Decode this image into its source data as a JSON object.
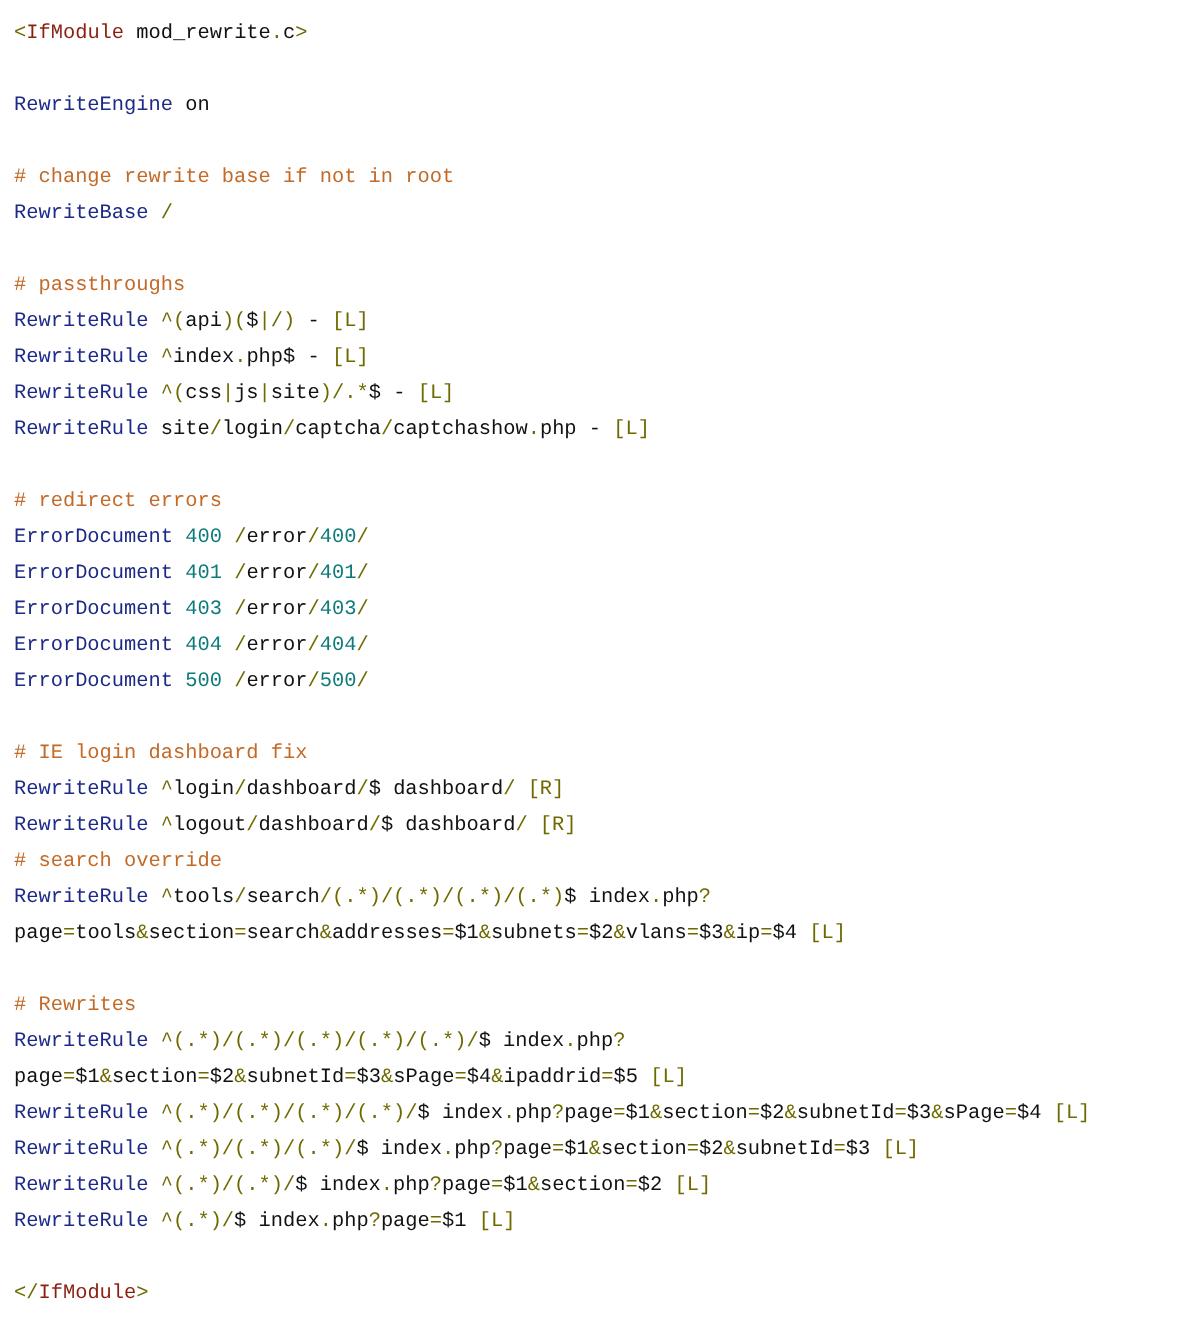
{
  "code_blocks": [
    {
      "lines": [
        [
          {
            "kind": "punct",
            "text": "<"
          },
          {
            "kind": "tag",
            "text": "IfModule"
          },
          {
            "kind": "plain",
            "text": " mod_rewrite"
          },
          {
            "kind": "punct",
            "text": "."
          },
          {
            "kind": "plain",
            "text": "c"
          },
          {
            "kind": "punct",
            "text": ">"
          }
        ]
      ]
    },
    {
      "lines": [
        [
          {
            "kind": "keyword",
            "text": "RewriteEngine"
          },
          {
            "kind": "plain",
            "text": " on"
          }
        ]
      ]
    },
    {
      "lines": [
        [
          {
            "kind": "comment",
            "text": "# change rewrite base if not in root"
          }
        ],
        [
          {
            "kind": "keyword",
            "text": "RewriteBase"
          },
          {
            "kind": "punct",
            "text": " /"
          }
        ]
      ]
    },
    {
      "lines": [
        [
          {
            "kind": "comment",
            "text": "# passthroughs"
          }
        ],
        [
          {
            "kind": "keyword",
            "text": "RewriteRule"
          },
          {
            "kind": "punct",
            "text": " ^("
          },
          {
            "kind": "plain",
            "text": "api"
          },
          {
            "kind": "punct",
            "text": ")("
          },
          {
            "kind": "plain",
            "text": "$"
          },
          {
            "kind": "punct",
            "text": "|/)"
          },
          {
            "kind": "plain",
            "text": " - "
          },
          {
            "kind": "punct",
            "text": "[L]"
          }
        ],
        [
          {
            "kind": "keyword",
            "text": "RewriteRule"
          },
          {
            "kind": "punct",
            "text": " ^"
          },
          {
            "kind": "plain",
            "text": "index"
          },
          {
            "kind": "punct",
            "text": "."
          },
          {
            "kind": "plain",
            "text": "php$ - "
          },
          {
            "kind": "punct",
            "text": "[L]"
          }
        ],
        [
          {
            "kind": "keyword",
            "text": "RewriteRule"
          },
          {
            "kind": "punct",
            "text": " ^("
          },
          {
            "kind": "plain",
            "text": "css"
          },
          {
            "kind": "punct",
            "text": "|"
          },
          {
            "kind": "plain",
            "text": "js"
          },
          {
            "kind": "punct",
            "text": "|"
          },
          {
            "kind": "plain",
            "text": "site"
          },
          {
            "kind": "punct",
            "text": ")/.*"
          },
          {
            "kind": "plain",
            "text": "$ - "
          },
          {
            "kind": "punct",
            "text": "[L]"
          }
        ],
        [
          {
            "kind": "keyword",
            "text": "RewriteRule"
          },
          {
            "kind": "plain",
            "text": " site"
          },
          {
            "kind": "punct",
            "text": "/"
          },
          {
            "kind": "plain",
            "text": "login"
          },
          {
            "kind": "punct",
            "text": "/"
          },
          {
            "kind": "plain",
            "text": "captcha"
          },
          {
            "kind": "punct",
            "text": "/"
          },
          {
            "kind": "plain",
            "text": "captchashow"
          },
          {
            "kind": "punct",
            "text": "."
          },
          {
            "kind": "plain",
            "text": "php - "
          },
          {
            "kind": "punct",
            "text": "[L]"
          }
        ]
      ]
    },
    {
      "lines": [
        [
          {
            "kind": "comment",
            "text": "# redirect errors"
          }
        ],
        [
          {
            "kind": "keyword",
            "text": "ErrorDocument"
          },
          {
            "kind": "number",
            "text": " 400"
          },
          {
            "kind": "punct",
            "text": " /"
          },
          {
            "kind": "plain",
            "text": "error"
          },
          {
            "kind": "punct",
            "text": "/"
          },
          {
            "kind": "number",
            "text": "400"
          },
          {
            "kind": "punct",
            "text": "/"
          }
        ],
        [
          {
            "kind": "keyword",
            "text": "ErrorDocument"
          },
          {
            "kind": "number",
            "text": " 401"
          },
          {
            "kind": "punct",
            "text": " /"
          },
          {
            "kind": "plain",
            "text": "error"
          },
          {
            "kind": "punct",
            "text": "/"
          },
          {
            "kind": "number",
            "text": "401"
          },
          {
            "kind": "punct",
            "text": "/"
          }
        ],
        [
          {
            "kind": "keyword",
            "text": "ErrorDocument"
          },
          {
            "kind": "number",
            "text": " 403"
          },
          {
            "kind": "punct",
            "text": " /"
          },
          {
            "kind": "plain",
            "text": "error"
          },
          {
            "kind": "punct",
            "text": "/"
          },
          {
            "kind": "number",
            "text": "403"
          },
          {
            "kind": "punct",
            "text": "/"
          }
        ],
        [
          {
            "kind": "keyword",
            "text": "ErrorDocument"
          },
          {
            "kind": "number",
            "text": " 404"
          },
          {
            "kind": "punct",
            "text": " /"
          },
          {
            "kind": "plain",
            "text": "error"
          },
          {
            "kind": "punct",
            "text": "/"
          },
          {
            "kind": "number",
            "text": "404"
          },
          {
            "kind": "punct",
            "text": "/"
          }
        ],
        [
          {
            "kind": "keyword",
            "text": "ErrorDocument"
          },
          {
            "kind": "number",
            "text": " 500"
          },
          {
            "kind": "punct",
            "text": " /"
          },
          {
            "kind": "plain",
            "text": "error"
          },
          {
            "kind": "punct",
            "text": "/"
          },
          {
            "kind": "number",
            "text": "500"
          },
          {
            "kind": "punct",
            "text": "/"
          }
        ]
      ]
    },
    {
      "lines": [
        [
          {
            "kind": "comment",
            "text": "# IE login dashboard fix"
          }
        ],
        [
          {
            "kind": "keyword",
            "text": "RewriteRule"
          },
          {
            "kind": "punct",
            "text": " ^"
          },
          {
            "kind": "plain",
            "text": "login"
          },
          {
            "kind": "punct",
            "text": "/"
          },
          {
            "kind": "plain",
            "text": "dashboard"
          },
          {
            "kind": "punct",
            "text": "/"
          },
          {
            "kind": "plain",
            "text": "$ dashboard"
          },
          {
            "kind": "punct",
            "text": "/ [R]"
          }
        ],
        [
          {
            "kind": "keyword",
            "text": "RewriteRule"
          },
          {
            "kind": "punct",
            "text": " ^"
          },
          {
            "kind": "plain",
            "text": "logout"
          },
          {
            "kind": "punct",
            "text": "/"
          },
          {
            "kind": "plain",
            "text": "dashboard"
          },
          {
            "kind": "punct",
            "text": "/"
          },
          {
            "kind": "plain",
            "text": "$ dashboard"
          },
          {
            "kind": "punct",
            "text": "/ [R]"
          }
        ],
        [
          {
            "kind": "comment",
            "text": "# search override"
          }
        ],
        [
          {
            "kind": "keyword",
            "text": "RewriteRule"
          },
          {
            "kind": "punct",
            "text": " ^"
          },
          {
            "kind": "plain",
            "text": "tools"
          },
          {
            "kind": "punct",
            "text": "/"
          },
          {
            "kind": "plain",
            "text": "search"
          },
          {
            "kind": "punct",
            "text": "/(.*)/(.*)/(.*)/(.*)"
          },
          {
            "kind": "plain",
            "text": "$ index"
          },
          {
            "kind": "punct",
            "text": "."
          },
          {
            "kind": "plain",
            "text": "php"
          },
          {
            "kind": "punct",
            "text": "?"
          }
        ],
        [
          {
            "kind": "plain",
            "text": "page"
          },
          {
            "kind": "punct",
            "text": "="
          },
          {
            "kind": "plain",
            "text": "tools"
          },
          {
            "kind": "punct",
            "text": "&"
          },
          {
            "kind": "plain",
            "text": "section"
          },
          {
            "kind": "punct",
            "text": "="
          },
          {
            "kind": "plain",
            "text": "search"
          },
          {
            "kind": "punct",
            "text": "&"
          },
          {
            "kind": "plain",
            "text": "addresses"
          },
          {
            "kind": "punct",
            "text": "="
          },
          {
            "kind": "plain",
            "text": "$1"
          },
          {
            "kind": "punct",
            "text": "&"
          },
          {
            "kind": "plain",
            "text": "subnets"
          },
          {
            "kind": "punct",
            "text": "="
          },
          {
            "kind": "plain",
            "text": "$2"
          },
          {
            "kind": "punct",
            "text": "&"
          },
          {
            "kind": "plain",
            "text": "vlans"
          },
          {
            "kind": "punct",
            "text": "="
          },
          {
            "kind": "plain",
            "text": "$3"
          },
          {
            "kind": "punct",
            "text": "&"
          },
          {
            "kind": "plain",
            "text": "ip"
          },
          {
            "kind": "punct",
            "text": "="
          },
          {
            "kind": "plain",
            "text": "$4 "
          },
          {
            "kind": "punct",
            "text": "[L]"
          }
        ]
      ]
    },
    {
      "lines": [
        [
          {
            "kind": "comment",
            "text": "# Rewrites"
          }
        ],
        [
          {
            "kind": "keyword",
            "text": "RewriteRule"
          },
          {
            "kind": "punct",
            "text": " ^(.*)/(.*)/(.*)/(.*)/(.*)/"
          },
          {
            "kind": "plain",
            "text": "$ index"
          },
          {
            "kind": "punct",
            "text": "."
          },
          {
            "kind": "plain",
            "text": "php"
          },
          {
            "kind": "punct",
            "text": "?"
          }
        ],
        [
          {
            "kind": "plain",
            "text": "page"
          },
          {
            "kind": "punct",
            "text": "="
          },
          {
            "kind": "plain",
            "text": "$1"
          },
          {
            "kind": "punct",
            "text": "&"
          },
          {
            "kind": "plain",
            "text": "section"
          },
          {
            "kind": "punct",
            "text": "="
          },
          {
            "kind": "plain",
            "text": "$2"
          },
          {
            "kind": "punct",
            "text": "&"
          },
          {
            "kind": "plain",
            "text": "subnetId"
          },
          {
            "kind": "punct",
            "text": "="
          },
          {
            "kind": "plain",
            "text": "$3"
          },
          {
            "kind": "punct",
            "text": "&"
          },
          {
            "kind": "plain",
            "text": "sPage"
          },
          {
            "kind": "punct",
            "text": "="
          },
          {
            "kind": "plain",
            "text": "$4"
          },
          {
            "kind": "punct",
            "text": "&"
          },
          {
            "kind": "plain",
            "text": "ipaddrid"
          },
          {
            "kind": "punct",
            "text": "="
          },
          {
            "kind": "plain",
            "text": "$5 "
          },
          {
            "kind": "punct",
            "text": "[L]"
          }
        ],
        [
          {
            "kind": "keyword",
            "text": "RewriteRule"
          },
          {
            "kind": "punct",
            "text": " ^(.*)/(.*)/(.*)/(.*)/"
          },
          {
            "kind": "plain",
            "text": "$ index"
          },
          {
            "kind": "punct",
            "text": "."
          },
          {
            "kind": "plain",
            "text": "php"
          },
          {
            "kind": "punct",
            "text": "?"
          },
          {
            "kind": "plain",
            "text": "page"
          },
          {
            "kind": "punct",
            "text": "="
          },
          {
            "kind": "plain",
            "text": "$1"
          },
          {
            "kind": "punct",
            "text": "&"
          },
          {
            "kind": "plain",
            "text": "section"
          },
          {
            "kind": "punct",
            "text": "="
          },
          {
            "kind": "plain",
            "text": "$2"
          },
          {
            "kind": "punct",
            "text": "&"
          },
          {
            "kind": "plain",
            "text": "subnetId"
          },
          {
            "kind": "punct",
            "text": "="
          },
          {
            "kind": "plain",
            "text": "$3"
          },
          {
            "kind": "punct",
            "text": "&"
          },
          {
            "kind": "plain",
            "text": "sPage"
          },
          {
            "kind": "punct",
            "text": "="
          },
          {
            "kind": "plain",
            "text": "$4 "
          },
          {
            "kind": "punct",
            "text": "[L]"
          }
        ],
        [
          {
            "kind": "keyword",
            "text": "RewriteRule"
          },
          {
            "kind": "punct",
            "text": " ^(.*)/(.*)/(.*)/"
          },
          {
            "kind": "plain",
            "text": "$ index"
          },
          {
            "kind": "punct",
            "text": "."
          },
          {
            "kind": "plain",
            "text": "php"
          },
          {
            "kind": "punct",
            "text": "?"
          },
          {
            "kind": "plain",
            "text": "page"
          },
          {
            "kind": "punct",
            "text": "="
          },
          {
            "kind": "plain",
            "text": "$1"
          },
          {
            "kind": "punct",
            "text": "&"
          },
          {
            "kind": "plain",
            "text": "section"
          },
          {
            "kind": "punct",
            "text": "="
          },
          {
            "kind": "plain",
            "text": "$2"
          },
          {
            "kind": "punct",
            "text": "&"
          },
          {
            "kind": "plain",
            "text": "subnetId"
          },
          {
            "kind": "punct",
            "text": "="
          },
          {
            "kind": "plain",
            "text": "$3 "
          },
          {
            "kind": "punct",
            "text": "[L]"
          }
        ],
        [
          {
            "kind": "keyword",
            "text": "RewriteRule"
          },
          {
            "kind": "punct",
            "text": " ^(.*)/(.*)/"
          },
          {
            "kind": "plain",
            "text": "$ index"
          },
          {
            "kind": "punct",
            "text": "."
          },
          {
            "kind": "plain",
            "text": "php"
          },
          {
            "kind": "punct",
            "text": "?"
          },
          {
            "kind": "plain",
            "text": "page"
          },
          {
            "kind": "punct",
            "text": "="
          },
          {
            "kind": "plain",
            "text": "$1"
          },
          {
            "kind": "punct",
            "text": "&"
          },
          {
            "kind": "plain",
            "text": "section"
          },
          {
            "kind": "punct",
            "text": "="
          },
          {
            "kind": "plain",
            "text": "$2 "
          },
          {
            "kind": "punct",
            "text": "[L]"
          }
        ],
        [
          {
            "kind": "keyword",
            "text": "RewriteRule"
          },
          {
            "kind": "punct",
            "text": " ^(.*)/"
          },
          {
            "kind": "plain",
            "text": "$ index"
          },
          {
            "kind": "punct",
            "text": "."
          },
          {
            "kind": "plain",
            "text": "php"
          },
          {
            "kind": "punct",
            "text": "?"
          },
          {
            "kind": "plain",
            "text": "page"
          },
          {
            "kind": "punct",
            "text": "="
          },
          {
            "kind": "plain",
            "text": "$1 "
          },
          {
            "kind": "punct",
            "text": "[L]"
          }
        ]
      ]
    },
    {
      "lines": [
        [
          {
            "kind": "punct",
            "text": "</"
          },
          {
            "kind": "tag",
            "text": "IfModule"
          },
          {
            "kind": "punct",
            "text": ">"
          }
        ]
      ]
    }
  ]
}
